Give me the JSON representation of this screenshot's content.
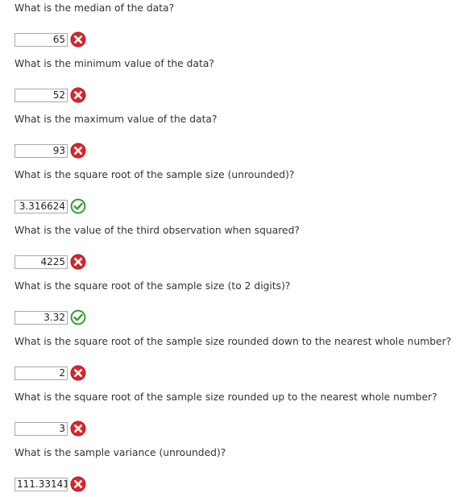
{
  "questions": [
    {
      "text": "What is the median of the data?",
      "answer": "65",
      "status": "incorrect",
      "icon": "x-circle-icon"
    },
    {
      "text": "What is the minimum value of the data?",
      "answer": "52",
      "status": "incorrect",
      "icon": "x-circle-icon"
    },
    {
      "text": "What is the maximum value of the data?",
      "answer": "93",
      "status": "incorrect",
      "icon": "x-circle-icon"
    },
    {
      "text": "What is the square root of the sample size (unrounded)?",
      "answer": "3.316624",
      "status": "correct",
      "icon": "check-circle-icon"
    },
    {
      "text": "What is the value of the third observation when squared?",
      "answer": "4225",
      "status": "incorrect",
      "icon": "x-circle-icon"
    },
    {
      "text": "What is the square root of the sample size (to 2 digits)?",
      "answer": "3.32",
      "status": "correct",
      "icon": "check-circle-icon"
    },
    {
      "text": "What is the square root of the sample size rounded down to the nearest whole number?",
      "answer": "2",
      "status": "incorrect",
      "icon": "x-circle-icon"
    },
    {
      "text": "What is the square root of the sample size rounded up to the nearest whole number?",
      "answer": "3",
      "status": "incorrect",
      "icon": "x-circle-icon"
    },
    {
      "text": "What is the sample variance (unrounded)?",
      "answer": "111.33141",
      "status": "incorrect",
      "icon": "x-circle-icon"
    }
  ],
  "colors": {
    "incorrect": "#d9262b",
    "correct": "#2e9e2e",
    "input_border": "#a9a9a9",
    "text": "#333333"
  }
}
